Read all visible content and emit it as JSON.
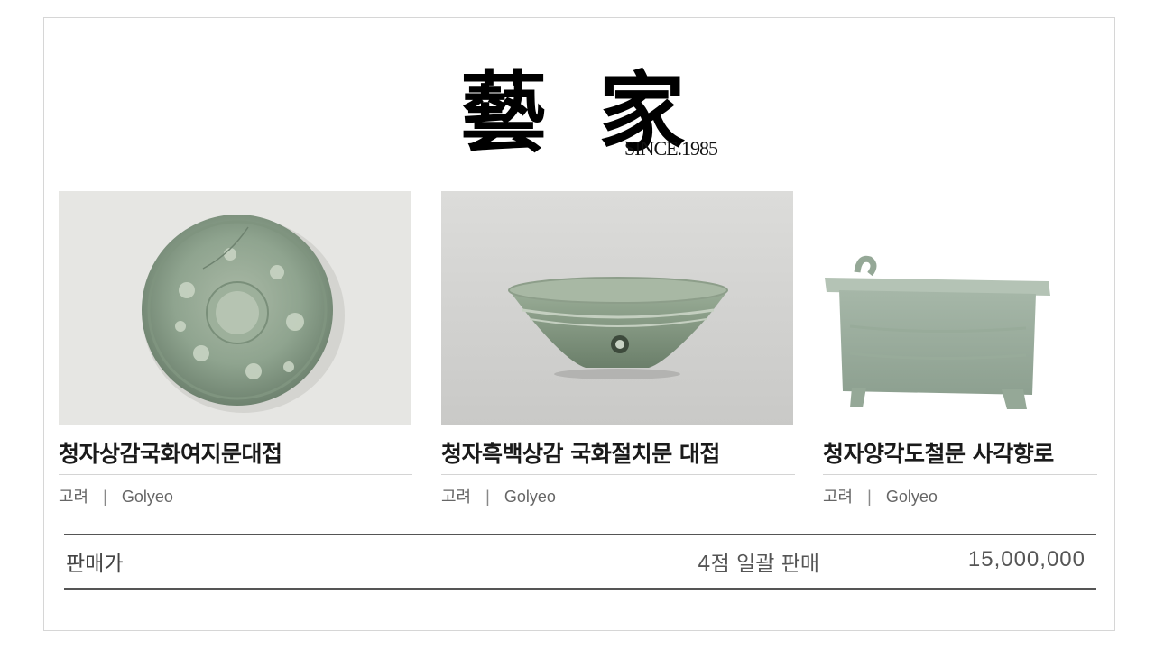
{
  "brand": {
    "name": "藝 家",
    "since": "SINCE.1985"
  },
  "products": [
    {
      "name": "청자상감국화여지문대접",
      "origin": "고려",
      "separator": "|",
      "origin_en": "Golyeo"
    },
    {
      "name": "청자흑백상감 국화절치문 대접",
      "origin": "고려",
      "separator": "|",
      "origin_en": "Golyeo"
    },
    {
      "name": "청자양각도철문 사각향로",
      "origin": "고려",
      "separator": "|",
      "origin_en": "Golyeo"
    }
  ],
  "price": {
    "label": "판매가",
    "description": "4점 일괄 판매",
    "value": "15,000,000"
  },
  "colors": {
    "celadon": "#8fa491",
    "celadon_dark": "#6c8270",
    "bg_photo_1": "#e7e7e5",
    "bg_photo_2": "#d4d4d2"
  }
}
